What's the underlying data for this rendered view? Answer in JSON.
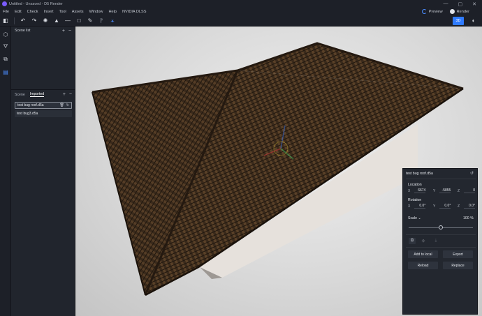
{
  "titlebar": {
    "title": "Untitled - Unsaved - D5 Render",
    "min": "—",
    "max": "▢",
    "close": "✕"
  },
  "menu": [
    "File",
    "Edit",
    "Check",
    "Insert",
    "Tool",
    "Assets",
    "Window",
    "Help",
    "NVIDIA DLSS"
  ],
  "menu_right": {
    "preview": "Preview",
    "render": "Render"
  },
  "toolbar": {
    "mode_3d": "3D"
  },
  "panel": {
    "scene_list_title": "Scene list",
    "tabs": [
      "Scene",
      "Imported"
    ],
    "active_tab": "Imported",
    "assets": [
      "test bug roof.d5a",
      "test bug3.d5a"
    ]
  },
  "properties": {
    "title": "test bug roof.d5a",
    "location": {
      "label": "Location",
      "x": "6674",
      "y": "-5855",
      "z": "0"
    },
    "rotation": {
      "label": "Rotation",
      "x": "0.0°",
      "y": "0.0°",
      "z": "0.0°"
    },
    "scale": {
      "label": "Scale",
      "value": "100",
      "unit": "%",
      "slider_fraction": 0.5
    },
    "buttons": {
      "add_to_local": "Add to local",
      "export": "Export",
      "reload": "Reload",
      "replace": "Replace"
    }
  },
  "colors": {
    "accent": "#2f7bff",
    "roof": "#3d2c1c",
    "wall": "#e6e1dc"
  }
}
